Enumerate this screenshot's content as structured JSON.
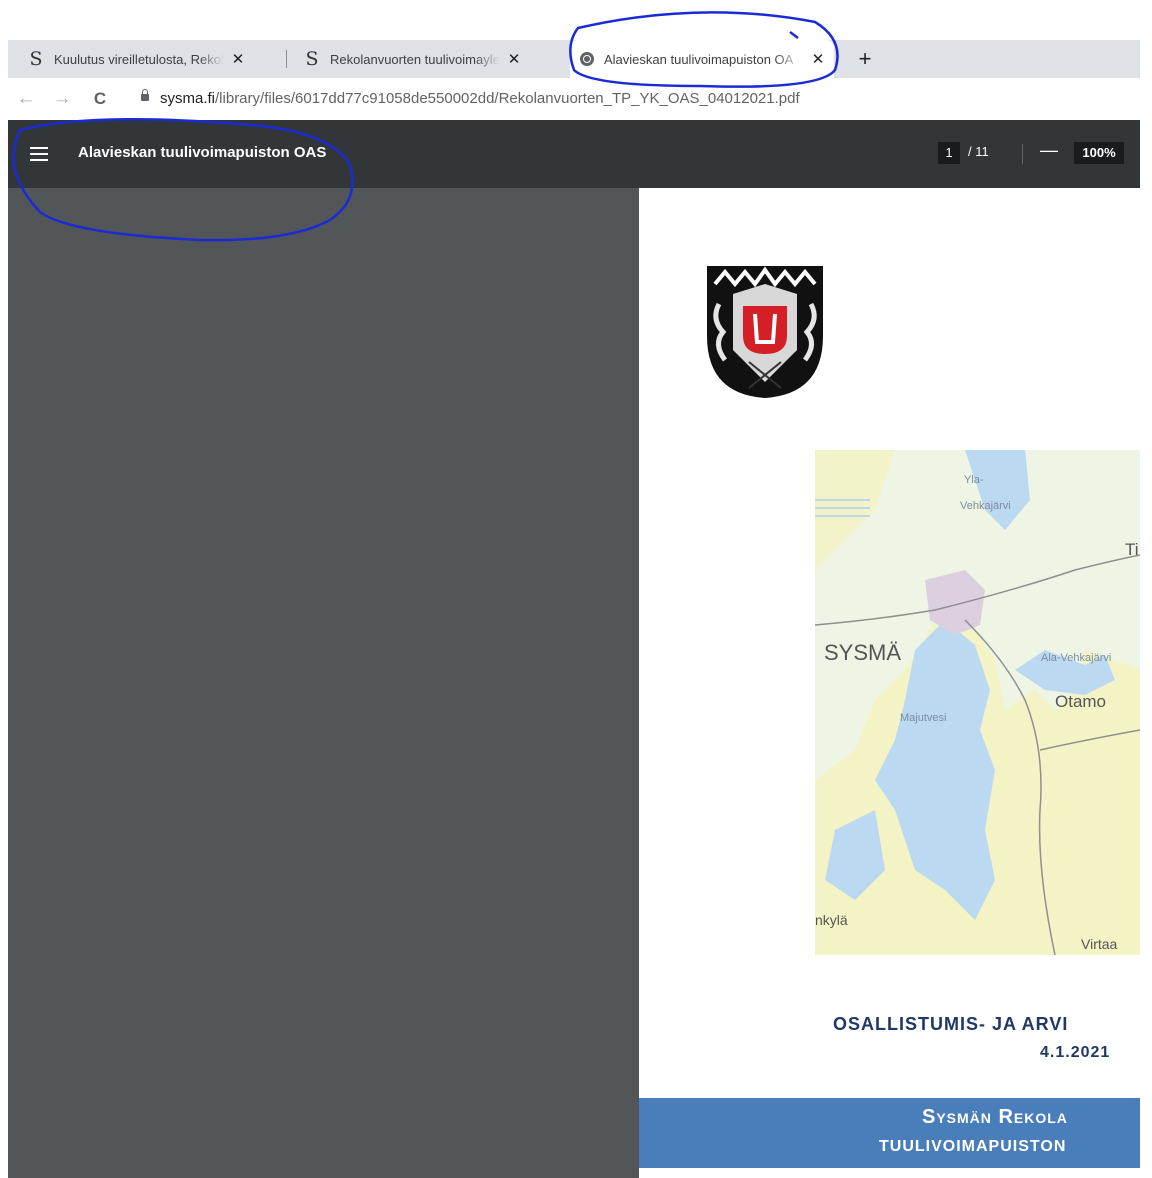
{
  "tabs": [
    {
      "favicon": "S",
      "title": "Kuulutus vireilletulosta, Rekolanv",
      "close": "✕"
    },
    {
      "favicon": "S",
      "title": "Rekolanvuorten tuulivoimayleisk",
      "close": "✕"
    },
    {
      "favicon": "globe-icon",
      "title": "Alavieskan tuulivoimapuiston OA",
      "close": "✕"
    }
  ],
  "new_tab": "+",
  "nav": {
    "back": "←",
    "forward": "→",
    "reload": "C"
  },
  "address": {
    "host": "sysma.fi",
    "path": "/library/files/6017dd77c91058de550002dd/Rekolanvuorten_TP_YK_OAS_04012021.pdf"
  },
  "pdf": {
    "title": "Alavieskan tuulivoimapuiston OAS",
    "page_current": "1",
    "page_total": "/ 11",
    "zoom_minus": "—",
    "zoom": "100%"
  },
  "map_labels": {
    "yla1": "Yla-",
    "yla2": "Vehkajärvi",
    "ti": "Ti",
    "sysma": "SYSMÄ",
    "ala": "Ala-Vehkajärvi",
    "otamo": "Otamo",
    "majutvesi": "Majutvesi",
    "nkyla": "nkylä",
    "virtaa": "Virtaa"
  },
  "document": {
    "heading1": "OSALLISTUMIS- JA ARVI",
    "heading2": "4.1.2021 ",
    "banner1": "Sysmän Rekola",
    "banner2": "TUULIVOIMAPUISTON"
  },
  "colors": {
    "pdf_toolbar": "#323639",
    "pdf_canvas": "#525659",
    "heading": "#1f3864",
    "banner": "#4a7ebb",
    "annotation": "#1a2bd6"
  }
}
